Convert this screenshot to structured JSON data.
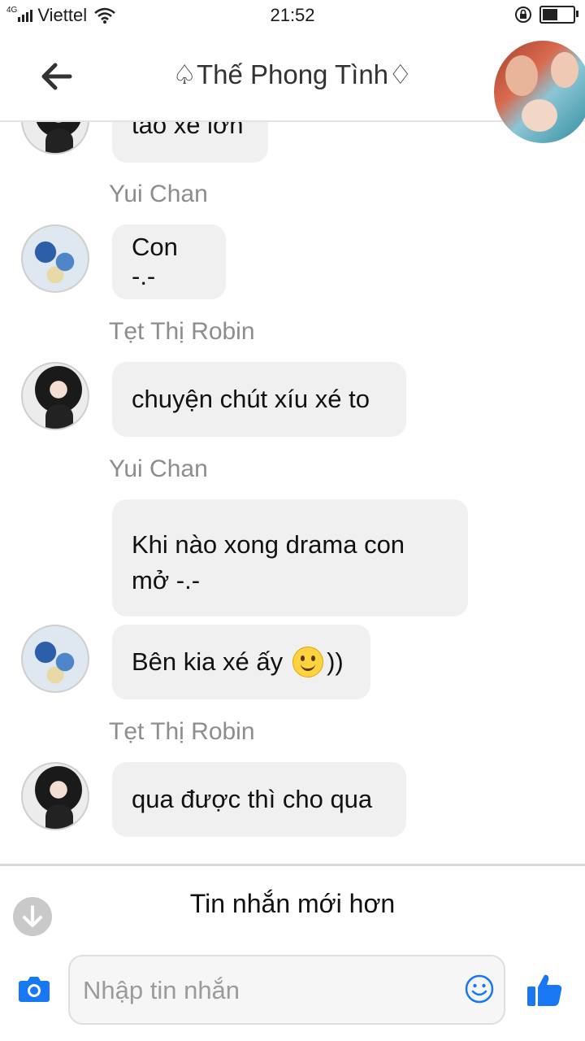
{
  "status": {
    "network": "4G",
    "carrier": "Viettel",
    "time": "21:52",
    "battery_level": 0.45
  },
  "header": {
    "title": "♤Thế Phong Tình♢",
    "back_icon": "back-arrow-icon"
  },
  "colors": {
    "accent": "#1877f2",
    "bubble": "#f1f0f0",
    "sender": "#8d8d8d"
  },
  "messages": [
    {
      "sender": "",
      "text": "tao xé lớn"
    },
    {
      "sender": "Yui Chan",
      "text": "Con -.-"
    },
    {
      "sender": "Tẹt Thị Robin",
      "text": "chuyện chút xíu xé to"
    },
    {
      "sender": "Yui Chan",
      "line1": "Khi nào xong drama con",
      "line2": "mở -.-"
    },
    {
      "sender": "",
      "text_before": "Bên kia xé ấy",
      "text_after": "))"
    },
    {
      "sender": "Tẹt Thị Robin",
      "text": "qua được thì cho qua"
    }
  ],
  "newer_messages": {
    "label": "Tin nhắn mới hơn"
  },
  "composer": {
    "placeholder": "Nhập tin nhắn"
  }
}
